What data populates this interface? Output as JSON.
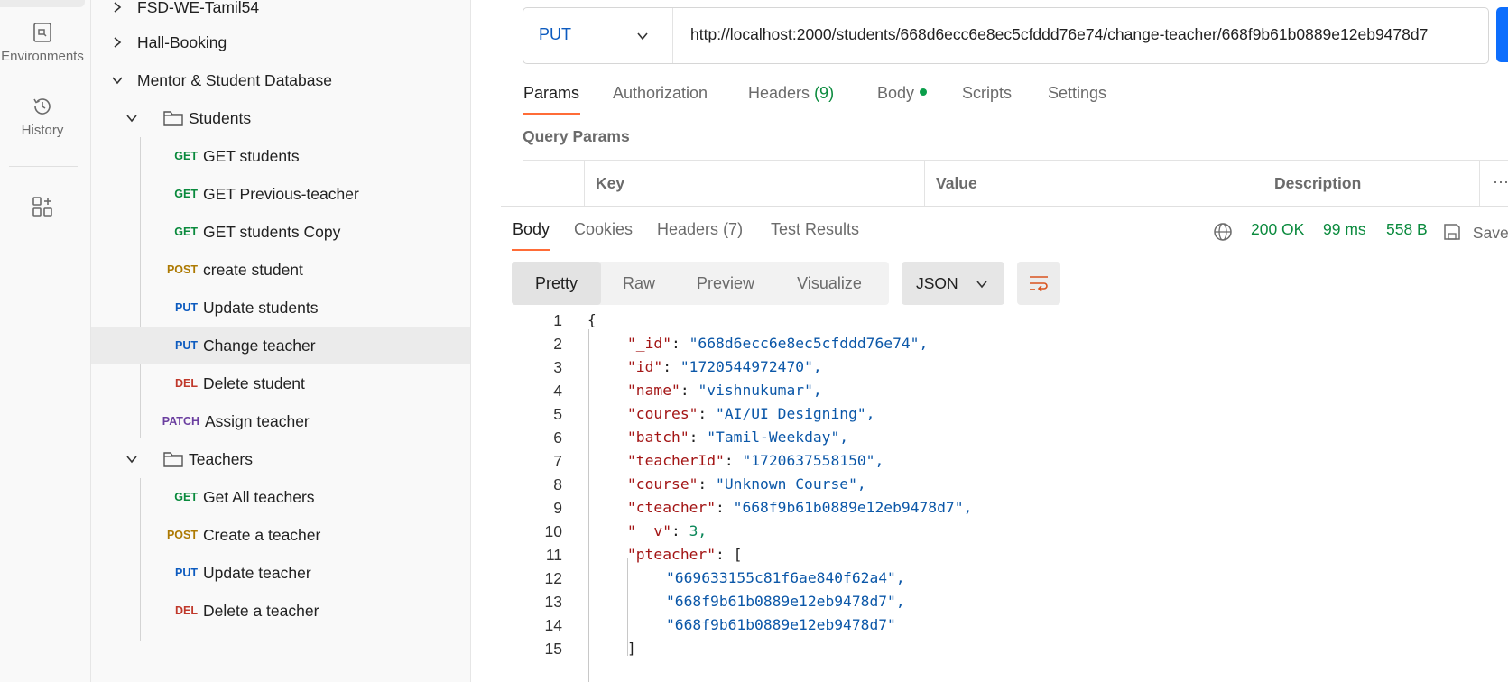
{
  "rail": {
    "environments_label": "Environments",
    "history_label": "History"
  },
  "tree": {
    "items": [
      {
        "label": "FSD-WE-Tamil54"
      },
      {
        "label": "Hall-Booking"
      },
      {
        "label": "Mentor & Student Database"
      },
      {
        "label": "Students"
      },
      {
        "method": "GET",
        "label": "GET students"
      },
      {
        "method": "GET",
        "label": "GET Previous-teacher"
      },
      {
        "method": "GET",
        "label": "GET students Copy"
      },
      {
        "method": "POST",
        "label": "create student"
      },
      {
        "method": "PUT",
        "label": "Update students"
      },
      {
        "method": "PUT",
        "label": "Change teacher"
      },
      {
        "method": "DEL",
        "label": "Delete student"
      },
      {
        "method": "PATCH",
        "label": "Assign teacher"
      },
      {
        "label": "Teachers"
      },
      {
        "method": "GET",
        "label": "Get All teachers"
      },
      {
        "method": "POST",
        "label": "Create a teacher"
      },
      {
        "method": "PUT",
        "label": "Update teacher"
      },
      {
        "method": "DEL",
        "label": "Delete a teacher"
      }
    ]
  },
  "request": {
    "method": "PUT",
    "url": "http://localhost:2000/students/668d6ecc6e8ec5cfddd76e74/change-teacher/668f9b61b0889e12eb9478d7",
    "tabs": {
      "params": "Params",
      "authorization": "Authorization",
      "headers": "Headers",
      "headers_count": "(9)",
      "body": "Body",
      "scripts": "Scripts",
      "settings": "Settings"
    },
    "query_params_title": "Query Params",
    "columns": [
      "Key",
      "Value",
      "Description"
    ]
  },
  "response": {
    "tabs": {
      "body": "Body",
      "cookies": "Cookies",
      "headers": "Headers",
      "headers_count": "(7)",
      "test_results": "Test Results"
    },
    "status": "200 OK",
    "time": "99 ms",
    "size": "558 B",
    "save_label": "Save",
    "view_modes": [
      "Pretty",
      "Raw",
      "Preview",
      "Visualize"
    ],
    "format": "JSON",
    "lines": [
      "{",
      "\"_id\": \"668d6ecc6e8ec5cfddd76e74\",",
      "\"id\": \"1720544972470\",",
      "\"name\": \"vishnukumar\",",
      "\"coures\": \"AI/UI Designing\",",
      "\"batch\": \"Tamil-Weekday\",",
      "\"teacherId\": \"1720637558150\",",
      "\"course\": \"Unknown Course\",",
      "\"cteacher\": \"668f9b61b0889e12eb9478d7\",",
      "\"__v\": 3,",
      "\"pteacher\": [",
      "\"669633155c81f6ae840f62a4\",",
      "\"668f9b61b0889e12eb9478d7\",",
      "\"668f9b61b0889e12eb9478d7\"",
      "]"
    ],
    "line_numbers": [
      "1",
      "2",
      "3",
      "4",
      "5",
      "6",
      "7",
      "8",
      "9",
      "10",
      "11",
      "12",
      "13",
      "14",
      "15"
    ]
  },
  "colors": {
    "get": "#0a8a3d",
    "post": "#ad7a03",
    "put": "#0d5bbf",
    "del": "#c0392b",
    "patch": "#6b3fa0",
    "accent": "#ff6c37"
  }
}
